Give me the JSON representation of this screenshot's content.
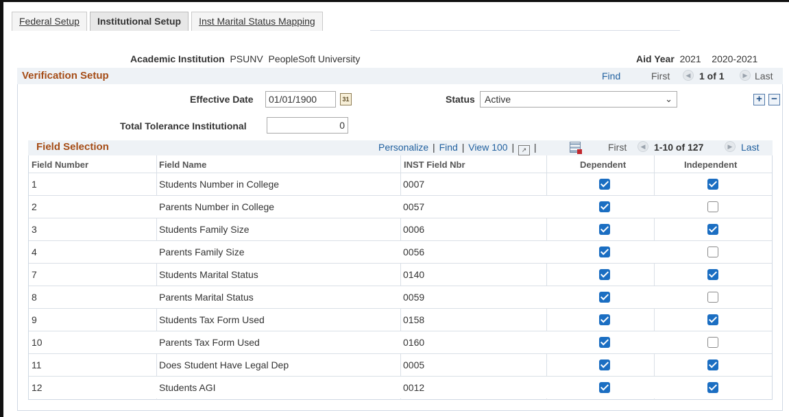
{
  "tabs": [
    {
      "label": "Federal Setup",
      "active": false
    },
    {
      "label": "Institutional Setup",
      "active": true
    },
    {
      "label": "Inst Marital Status Mapping",
      "active": false
    }
  ],
  "header": {
    "institution_label": "Academic Institution",
    "institution_code": "PSUNV",
    "institution_name": "PeopleSoft University",
    "aid_year_label": "Aid Year",
    "aid_year": "2021",
    "aid_year_desc": "2020-2021"
  },
  "verification": {
    "title": "Verification Setup",
    "find": "Find",
    "first": "First",
    "count": "1 of 1",
    "last": "Last",
    "effective_date_label": "Effective Date",
    "effective_date": "01/01/1900",
    "status_label": "Status",
    "status_value": "Active",
    "tolerance_label": "Total Tolerance Institutional",
    "tolerance_value": "0"
  },
  "grid": {
    "title": "Field Selection",
    "personalize": "Personalize",
    "find": "Find",
    "view": "View 100",
    "first": "First",
    "count": "1-10 of 127",
    "last": "Last",
    "columns": {
      "field_number": "Field Number",
      "field_name": "Field Name",
      "inst_field": "INST Field Nbr",
      "dependent": "Dependent",
      "independent": "Independent"
    },
    "rows": [
      {
        "num": "1",
        "name": "Students Number in College",
        "inst": "0007",
        "dep": true,
        "ind": true
      },
      {
        "num": "2",
        "name": "Parents Number in College",
        "inst": "0057",
        "dep": true,
        "ind": false
      },
      {
        "num": "3",
        "name": "Students Family Size",
        "inst": "0006",
        "dep": true,
        "ind": true
      },
      {
        "num": "4",
        "name": "Parents Family Size",
        "inst": "0056",
        "dep": true,
        "ind": false
      },
      {
        "num": "7",
        "name": "Students Marital Status",
        "inst": "0140",
        "dep": true,
        "ind": true
      },
      {
        "num": "8",
        "name": "Parents Marital Status",
        "inst": "0059",
        "dep": true,
        "ind": false
      },
      {
        "num": "9",
        "name": "Students Tax Form Used",
        "inst": "0158",
        "dep": true,
        "ind": true
      },
      {
        "num": "10",
        "name": "Parents Tax Form Used",
        "inst": "0160",
        "dep": true,
        "ind": false
      },
      {
        "num": "11",
        "name": "Does Student Have Legal Dep",
        "inst": "0005",
        "dep": true,
        "ind": true
      },
      {
        "num": "12",
        "name": "Students AGI",
        "inst": "0012",
        "dep": true,
        "ind": true
      }
    ]
  },
  "colors": {
    "section_title": "#a54c16",
    "link": "#1f5f9e",
    "checkbox": "#1b6ec2"
  },
  "icons": {
    "calendar": "calendar-icon",
    "add": "plus-icon",
    "delete": "minus-icon",
    "zoom": "zoom-icon",
    "download": "download-icon"
  }
}
